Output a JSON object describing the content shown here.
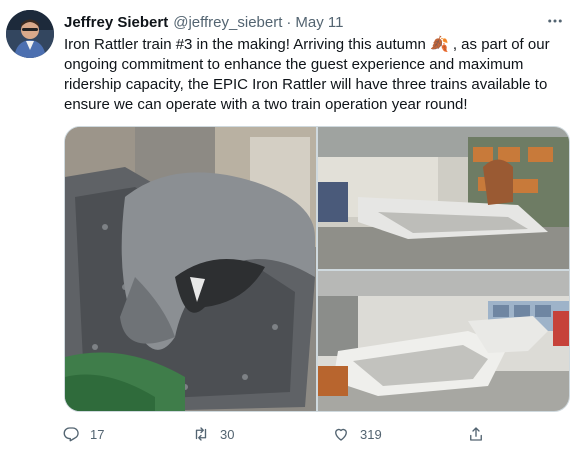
{
  "tweet": {
    "author_name": "Jeffrey Siebert",
    "author_handle": "@jeffrey_siebert",
    "separator": "·",
    "date": "May 11",
    "text": "Iron Rattler train #3 in the making! Arriving this autumn 🍂 , as part of our ongoing commitment to enhance the guest experience and maximum ridership capacity, the EPIC Iron Rattler will have three trains available to ensure we can operate with a two train operation year round!"
  },
  "media": [
    {
      "name": "rattlesnake-head-sculpture",
      "icon": "photo"
    },
    {
      "name": "train-car-frame-factory",
      "icon": "photo"
    },
    {
      "name": "train-chassis-assembly-hall",
      "icon": "photo"
    }
  ],
  "actions": {
    "reply_count": "17",
    "retweet_count": "30",
    "like_count": "319",
    "icons": [
      "reply-icon",
      "retweet-icon",
      "like-icon",
      "share-icon"
    ]
  },
  "colors": {
    "text_primary": "#0f1419",
    "text_secondary": "#536471",
    "border": "#cfd9de"
  }
}
